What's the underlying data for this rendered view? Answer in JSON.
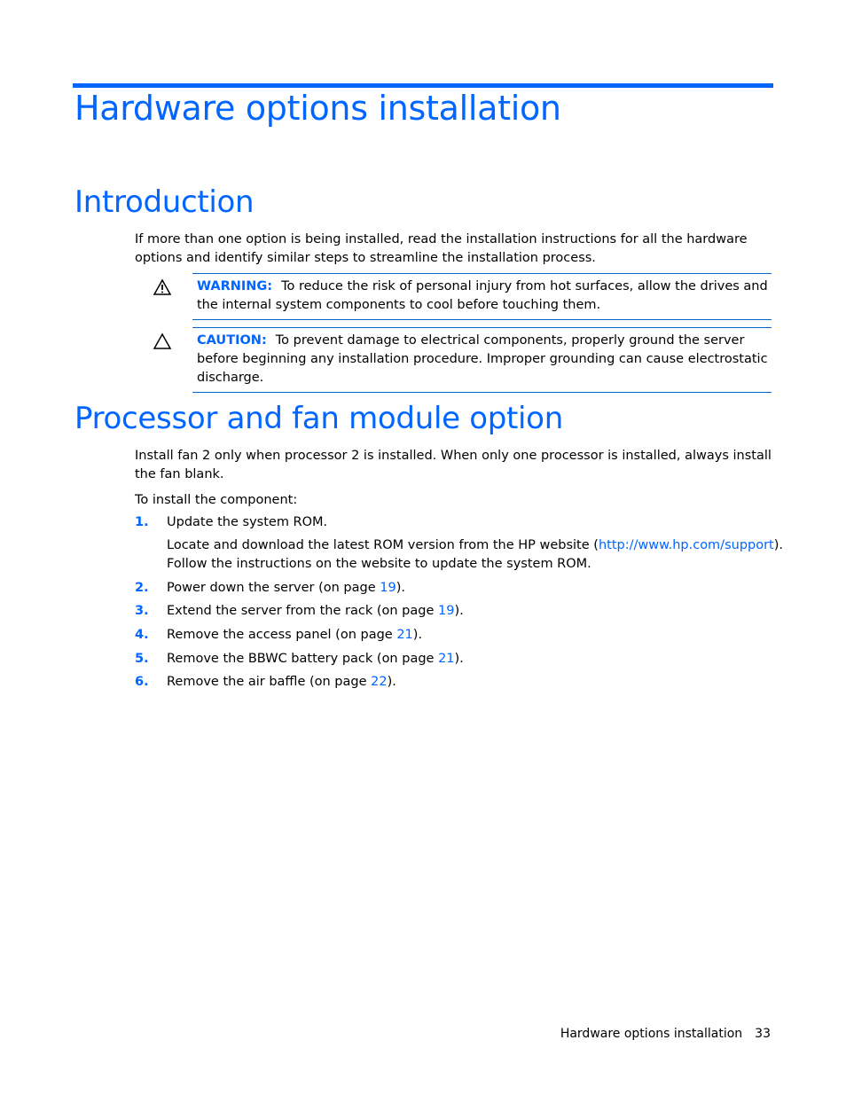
{
  "page": {
    "chapter_title": "Hardware options installation",
    "sections": [
      {
        "title": "Introduction",
        "paragraph": "If more than one option is being installed, read the installation instructions for all the hardware options and identify similar steps to streamline the installation process.",
        "notes": [
          {
            "type": "warning",
            "icon": "warning-triangle-icon",
            "label": "WARNING:",
            "text": "To reduce the risk of personal injury from hot surfaces, allow the drives and the internal system components to cool before touching them."
          },
          {
            "type": "caution",
            "icon": "caution-triangle-icon",
            "label": "CAUTION:",
            "text": "To prevent damage to electrical components, properly ground the server before beginning any installation procedure. Improper grounding can cause electrostatic discharge."
          }
        ]
      },
      {
        "title": "Processor and fan module option",
        "paragraph": "Install fan 2 only when processor 2 is installed. When only one processor is installed, always install the fan blank.",
        "intro": "To install the component:",
        "steps": [
          {
            "num": "1.",
            "text": "Update the system ROM.",
            "sub_pre": "Locate and download the latest ROM version from the HP website (",
            "sub_link": "http://www.hp.com/support",
            "sub_post": ").",
            "sub_line2": "Follow the instructions on the website to update the system ROM."
          },
          {
            "num": "2.",
            "pre": "Power down the server (on page ",
            "page": "19",
            "post": ")."
          },
          {
            "num": "3.",
            "pre": "Extend the server from the rack (on page ",
            "page": "19",
            "post": ")."
          },
          {
            "num": "4.",
            "pre": "Remove the access panel (on page ",
            "page": "21",
            "post": ")."
          },
          {
            "num": "5.",
            "pre": "Remove the BBWC battery pack (on page ",
            "page": "21",
            "post": ")."
          },
          {
            "num": "6.",
            "pre": "Remove the air baffle (on page ",
            "page": "22",
            "post": ")."
          }
        ]
      }
    ],
    "footer": {
      "section": "Hardware options installation",
      "page_number": "33"
    }
  }
}
